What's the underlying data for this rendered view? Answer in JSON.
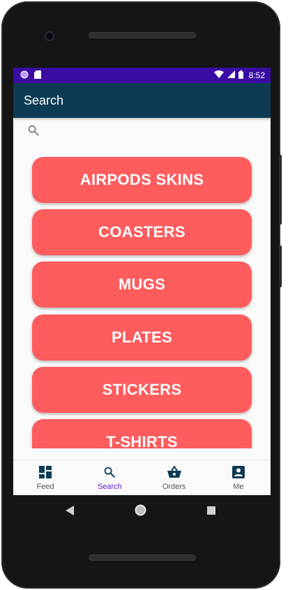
{
  "status_bar": {
    "time": "8:52"
  },
  "app_bar": {
    "title": "Search"
  },
  "search": {
    "icon": "search-icon"
  },
  "categories": [
    {
      "label": "AIRPODS SKINS"
    },
    {
      "label": "COASTERS"
    },
    {
      "label": "MUGS"
    },
    {
      "label": "PLATES"
    },
    {
      "label": "STICKERS"
    },
    {
      "label": "T-SHIRTS"
    }
  ],
  "bottom_nav": {
    "active": "Search",
    "items": [
      {
        "label": "Feed",
        "icon": "dashboard-icon"
      },
      {
        "label": "Search",
        "icon": "search-icon"
      },
      {
        "label": "Orders",
        "icon": "basket-icon"
      },
      {
        "label": "Me",
        "icon": "account-box-icon"
      }
    ]
  },
  "colors": {
    "status_bar": "#3a0ca3",
    "app_bar": "#0d3b54",
    "button": "#ff5c5e",
    "nav_active": "#5b1bd1"
  }
}
